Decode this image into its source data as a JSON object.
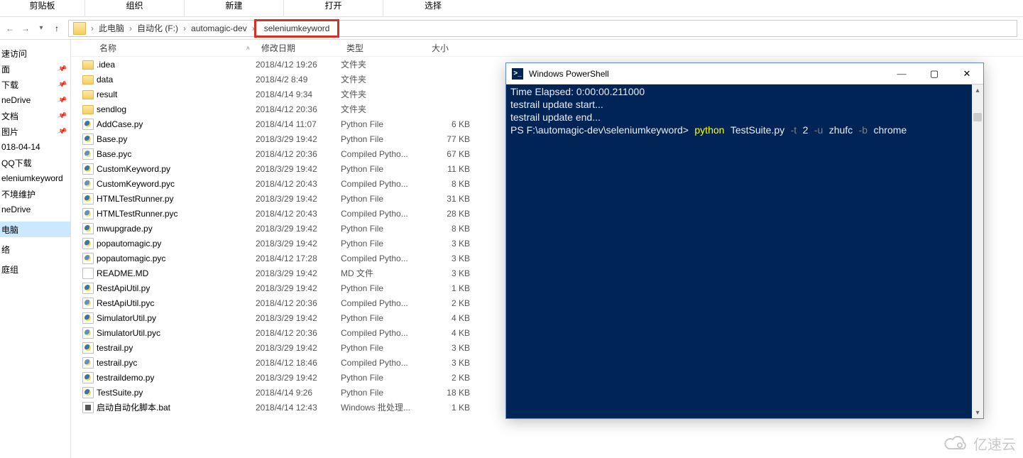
{
  "ribbon": {
    "sections": [
      "剪贴板",
      "组织",
      "新建",
      "打开",
      "选择"
    ]
  },
  "nav": {
    "back_aria": "返回",
    "fwd_aria": "前进",
    "up_aria": "上一级",
    "breadcrumbs": [
      "此电脑",
      "自动化 (F:)",
      "automagic-dev",
      "seleniumkeyword"
    ]
  },
  "sidebar": {
    "items": [
      {
        "label": "速访问",
        "pinned": false
      },
      {
        "label": "面",
        "pinned": true
      },
      {
        "label": "下载",
        "pinned": true
      },
      {
        "label": "neDrive",
        "pinned": true
      },
      {
        "label": "文档",
        "pinned": true
      },
      {
        "label": "图片",
        "pinned": true
      },
      {
        "label": "018-04-14",
        "pinned": false
      },
      {
        "label": "QQ下载",
        "pinned": false
      },
      {
        "label": "eleniumkeyword",
        "pinned": false
      },
      {
        "label": "不境维护",
        "pinned": false
      },
      {
        "label": "neDrive",
        "pinned": false
      },
      {
        "label": "电脑",
        "pinned": false,
        "selected": true
      },
      {
        "label": "络",
        "pinned": false
      },
      {
        "label": "庭组",
        "pinned": false
      }
    ]
  },
  "columns": {
    "name": "名称",
    "date": "修改日期",
    "type": "类型",
    "size": "大小"
  },
  "files": [
    {
      "ico": "folder",
      "name": ".idea",
      "date": "2018/4/12 19:26",
      "type": "文件夹",
      "size": ""
    },
    {
      "ico": "folder",
      "name": "data",
      "date": "2018/4/2 8:49",
      "type": "文件夹",
      "size": ""
    },
    {
      "ico": "folder",
      "name": "result",
      "date": "2018/4/14 9:34",
      "type": "文件夹",
      "size": ""
    },
    {
      "ico": "folder",
      "name": "sendlog",
      "date": "2018/4/12 20:36",
      "type": "文件夹",
      "size": ""
    },
    {
      "ico": "py",
      "name": "AddCase.py",
      "date": "2018/4/14 11:07",
      "type": "Python File",
      "size": "6 KB"
    },
    {
      "ico": "py",
      "name": "Base.py",
      "date": "2018/3/29 19:42",
      "type": "Python File",
      "size": "77 KB"
    },
    {
      "ico": "pyc",
      "name": "Base.pyc",
      "date": "2018/4/12 20:36",
      "type": "Compiled Pytho...",
      "size": "67 KB"
    },
    {
      "ico": "py",
      "name": "CustomKeyword.py",
      "date": "2018/3/29 19:42",
      "type": "Python File",
      "size": "11 KB"
    },
    {
      "ico": "pyc",
      "name": "CustomKeyword.pyc",
      "date": "2018/4/12 20:43",
      "type": "Compiled Pytho...",
      "size": "8 KB"
    },
    {
      "ico": "py",
      "name": "HTMLTestRunner.py",
      "date": "2018/3/29 19:42",
      "type": "Python File",
      "size": "31 KB"
    },
    {
      "ico": "pyc",
      "name": "HTMLTestRunner.pyc",
      "date": "2018/4/12 20:43",
      "type": "Compiled Pytho...",
      "size": "28 KB"
    },
    {
      "ico": "py",
      "name": "mwupgrade.py",
      "date": "2018/3/29 19:42",
      "type": "Python File",
      "size": "8 KB"
    },
    {
      "ico": "py",
      "name": "popautomagic.py",
      "date": "2018/3/29 19:42",
      "type": "Python File",
      "size": "3 KB"
    },
    {
      "ico": "pyc",
      "name": "popautomagic.pyc",
      "date": "2018/4/12 17:28",
      "type": "Compiled Pytho...",
      "size": "3 KB"
    },
    {
      "ico": "md",
      "name": "README.MD",
      "date": "2018/3/29 19:42",
      "type": "MD 文件",
      "size": "3 KB"
    },
    {
      "ico": "py",
      "name": "RestApiUtil.py",
      "date": "2018/3/29 19:42",
      "type": "Python File",
      "size": "1 KB"
    },
    {
      "ico": "pyc",
      "name": "RestApiUtil.pyc",
      "date": "2018/4/12 20:36",
      "type": "Compiled Pytho...",
      "size": "2 KB"
    },
    {
      "ico": "py",
      "name": "SimulatorUtil.py",
      "date": "2018/3/29 19:42",
      "type": "Python File",
      "size": "4 KB"
    },
    {
      "ico": "pyc",
      "name": "SimulatorUtil.pyc",
      "date": "2018/4/12 20:36",
      "type": "Compiled Pytho...",
      "size": "4 KB"
    },
    {
      "ico": "py",
      "name": "testrail.py",
      "date": "2018/3/29 19:42",
      "type": "Python File",
      "size": "3 KB"
    },
    {
      "ico": "pyc",
      "name": "testrail.pyc",
      "date": "2018/4/12 18:46",
      "type": "Compiled Pytho...",
      "size": "3 KB"
    },
    {
      "ico": "py",
      "name": "testraildemo.py",
      "date": "2018/3/29 19:42",
      "type": "Python File",
      "size": "2 KB"
    },
    {
      "ico": "py",
      "name": "TestSuite.py",
      "date": "2018/4/14 9:26",
      "type": "Python File",
      "size": "18 KB"
    },
    {
      "ico": "bat",
      "name": "启动自动化脚本.bat",
      "date": "2018/4/14 12:43",
      "type": "Windows 批处理...",
      "size": "1 KB"
    }
  ],
  "powershell": {
    "title": "Windows PowerShell",
    "line1": "Time Elapsed: 0:00:00.211000",
    "line2": "testrail update start...",
    "line3": "testrail update end...",
    "prompt": "PS F:\\automagic-dev\\seleniumkeyword>",
    "cmd": "python",
    "arg_file": "TestSuite.py",
    "flag_t": "-t",
    "val_t": "2",
    "flag_u": "-u",
    "val_u": "zhufc",
    "flag_b": "-b",
    "val_b": "chrome"
  },
  "watermark": "亿速云"
}
